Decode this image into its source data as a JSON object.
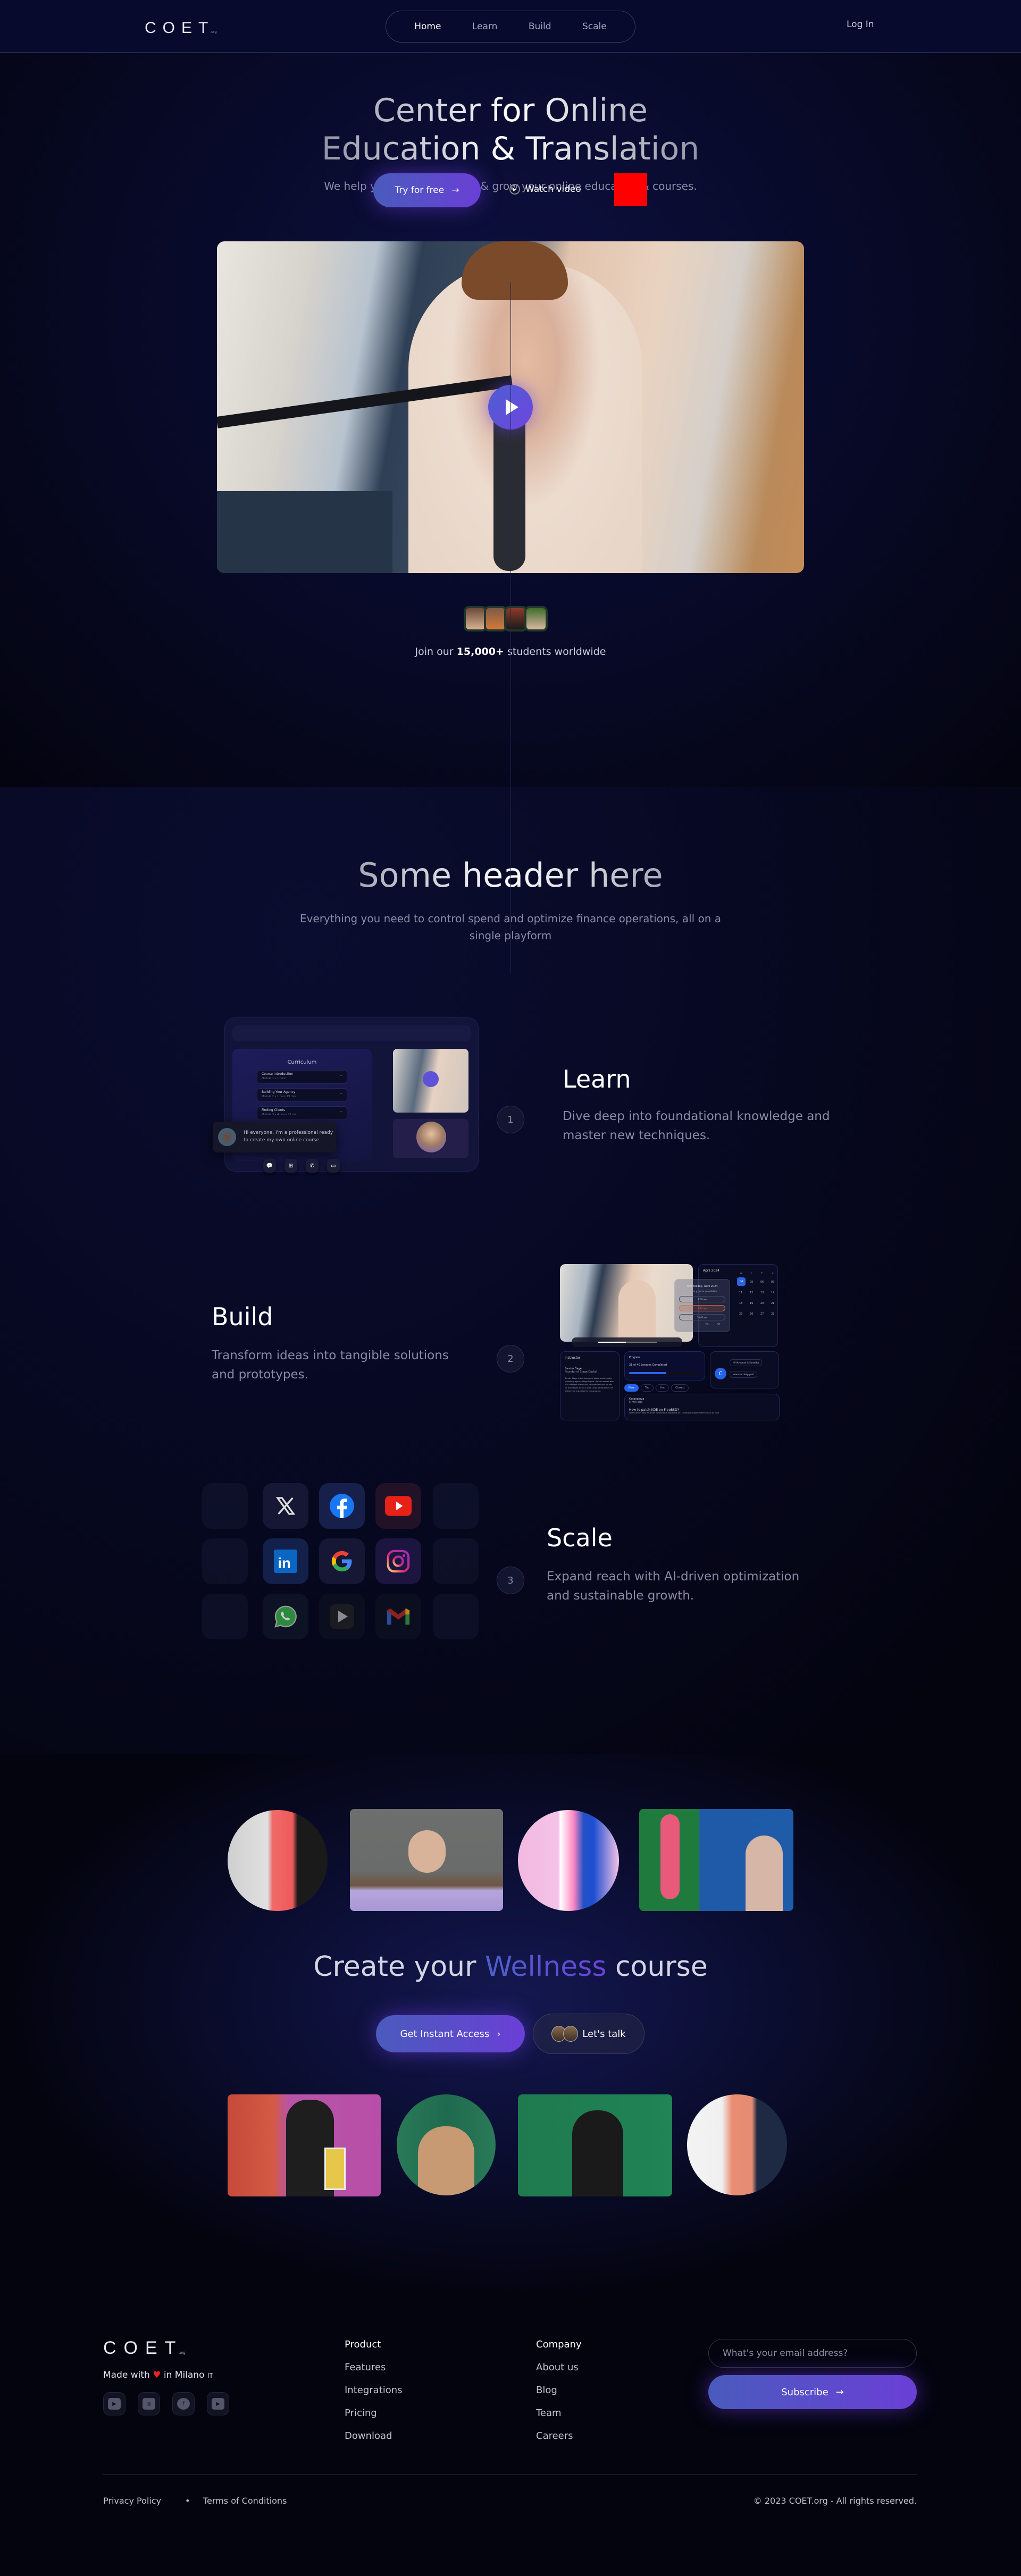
{
  "nav": {
    "logo": "COET",
    "logo_suffix": ".org",
    "items": [
      {
        "label": "Home",
        "active": true
      },
      {
        "label": "Learn",
        "active": false
      },
      {
        "label": "Build",
        "active": false
      },
      {
        "label": "Scale",
        "active": false
      }
    ],
    "login": "Log In"
  },
  "hero": {
    "title_line1": "Center for Online",
    "title_line2": "Education & Translation",
    "subtitle": "We help you create, manage & grow your online education & courses.",
    "cta_primary": "Try for free",
    "cta_primary_icon": "arrow-right-icon",
    "cta_secondary": "Watch video",
    "cta_secondary_icon": "play-circle-icon",
    "video_play_icon": "play-icon",
    "join_prefix": "Join our",
    "join_count": "15,000+",
    "join_suffix": "students worldwide"
  },
  "features": {
    "title": "Some header here",
    "subtitle": "Everything you need to control spend and optimize finance operations, all on a single playform",
    "steps": [
      {
        "num": "1",
        "title": "Learn",
        "desc": "Dive deep into foundational knowledge and master new techniques."
      },
      {
        "num": "2",
        "title": "Build",
        "desc": "Transform ideas into tangible solutions and prototypes."
      },
      {
        "num": "3",
        "title": "Scale",
        "desc": "Expand reach with AI-driven optimization and sustainable growth."
      }
    ],
    "learn_card": {
      "curriculum_title": "Curriculum",
      "modules": [
        {
          "title": "Course Introduction",
          "meta": "Module 1 • 1 hour"
        },
        {
          "title": "Building Your Agency",
          "meta": "Module 2 • 1 hour 19 min"
        },
        {
          "title": "Finding Clients",
          "meta": "Module 3 • 4 hours 21 min"
        }
      ],
      "chat_message": "Hi everyone, I'm a professional ready to create my own online course",
      "action_icons": [
        "chat-icon",
        "classroom-icon",
        "phone-icon",
        "screen-share-icon"
      ]
    },
    "build_card": {
      "calendar_month": "April 2024",
      "calendar_days_header": [
        "w",
        "t",
        "f",
        "s"
      ],
      "calendar_rows": [
        [
          "04",
          "05",
          "06",
          "07"
        ],
        [
          "11",
          "12",
          "13",
          "14"
        ],
        [
          "18",
          "19",
          "20",
          "21"
        ],
        [
          "25",
          "26",
          "27",
          "28"
        ],
        [
          "29",
          "30",
          "01",
          "02",
          "03",
          "04",
          "05"
        ]
      ],
      "calendar_selected": "04",
      "availability_title": "Wednesday, April 2024",
      "availability_label": "Times you're available",
      "slots": [
        "9:00 am",
        "9:30 am",
        "10:00 am"
      ],
      "instructor_heading": "Instructor",
      "instructor_name": "Sander Sage",
      "instructor_role": "Founder of Stage Digital",
      "instructor_bio": "Sander Stage is the founder of global social media marketing agency Stage Digital. He has worked with 30+ different clients and has spent millions on ads for businesses across a wide range of industries. He will be your instructor for the program.",
      "progress_heading": "Progress",
      "progress_text": "21 of 40 Lessons Completed",
      "progress_done": 21,
      "progress_total": 40,
      "tabs": [
        "New",
        "Top",
        "Hot",
        "Closed"
      ],
      "active_tab": "New",
      "post_author": "Golanginya",
      "post_time": "5 min ago",
      "post_title": "How to patch KDE on FreeBSD?",
      "post_body": "Lorem ipsum dolor sit amet, consectetur adipiscing elit. Consequat aliquet maecenas ut sit nulla",
      "bot_messages": [
        "Hi! My name is SomeBot",
        "How can I help you?"
      ]
    },
    "scale_icons": [
      [
        "x-icon",
        "facebook-icon",
        "youtube-icon"
      ],
      [
        "linkedin-icon",
        "google-icon",
        "instagram-icon"
      ],
      [
        "whatsapp-icon",
        "play-store-icon",
        "gmail-icon"
      ]
    ]
  },
  "cta": {
    "title_pre": "Create your",
    "title_highlight": "Wellness",
    "title_post": "course",
    "primary": "Get Instant Access",
    "secondary": "Let's talk"
  },
  "footer": {
    "logo": "COET",
    "logo_suffix": ".org",
    "made_with_pre": "Made with",
    "made_with_post": "in Milano",
    "made_flag": "IT",
    "socials": [
      "youtube-icon",
      "instagram-icon",
      "facebook-icon",
      "youtube-icon"
    ],
    "product_heading": "Product",
    "product_links": [
      "Features",
      "Integrations",
      "Pricing",
      "Download"
    ],
    "company_heading": "Company",
    "company_links": [
      "About us",
      "Blog",
      "Team",
      "Careers"
    ],
    "email_placeholder": "What's your email address?",
    "subscribe": "Subscribe",
    "privacy": "Privacy Policy",
    "terms": "Terms of Conditions",
    "copyright": "© 2023 COET.org - All rights reserved."
  },
  "colors": {
    "background": "#04040f",
    "nav_bg": "#070a2c",
    "accent_start": "#4a5bbd",
    "accent_end": "#6a3fd6",
    "red_box": "#ff0000"
  }
}
